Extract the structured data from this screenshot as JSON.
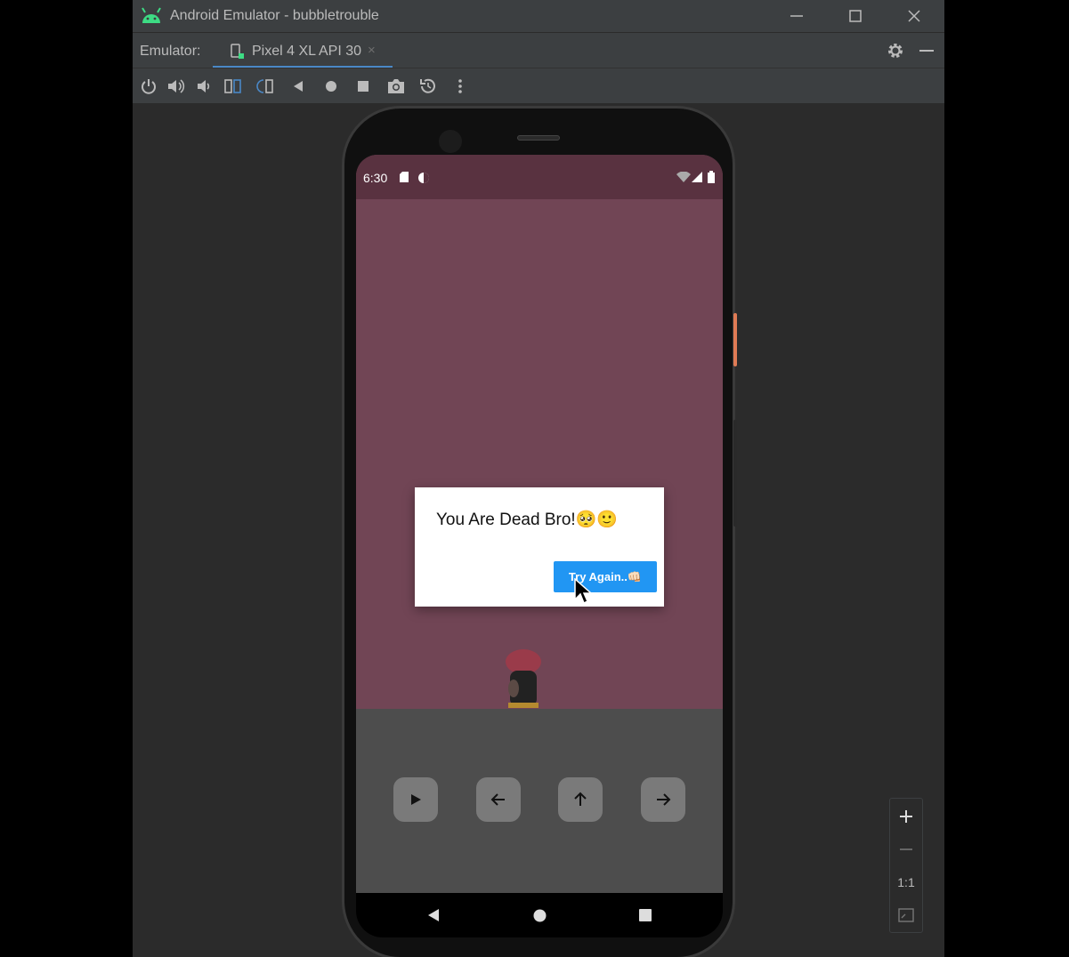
{
  "window": {
    "title": "Android Emulator - bubbletrouble",
    "app_icon": "android-icon",
    "controls": [
      "minimize-icon",
      "maximize-icon",
      "close-icon"
    ]
  },
  "tabbar": {
    "label": "Emulator:",
    "tab_label": "Pixel 4 XL API 30",
    "tab_close": "×",
    "settings_icon": "gear-icon"
  },
  "toolbar": {
    "icons": [
      "power-icon",
      "volume-up-icon",
      "volume-down-icon",
      "rotate-left-icon",
      "rotate-right-icon",
      "back-icon",
      "home-icon",
      "overview-icon",
      "camera-icon",
      "snapshot-icon",
      "more-icon"
    ]
  },
  "device": {
    "status_time": "6:30",
    "dialog_message": "You Are Dead Bro!🥺🙂",
    "dialog_button": "Try Again..👊🏻",
    "controls": [
      "play-icon",
      "arrow-left-icon",
      "arrow-up-icon",
      "arrow-right-icon"
    ]
  },
  "zoom": {
    "one_to_one": "1:1"
  },
  "colors": {
    "game_bg": "#714555",
    "status_bar": "#593240",
    "accent": "#2196f3",
    "tab_underline": "#4a88c7"
  }
}
